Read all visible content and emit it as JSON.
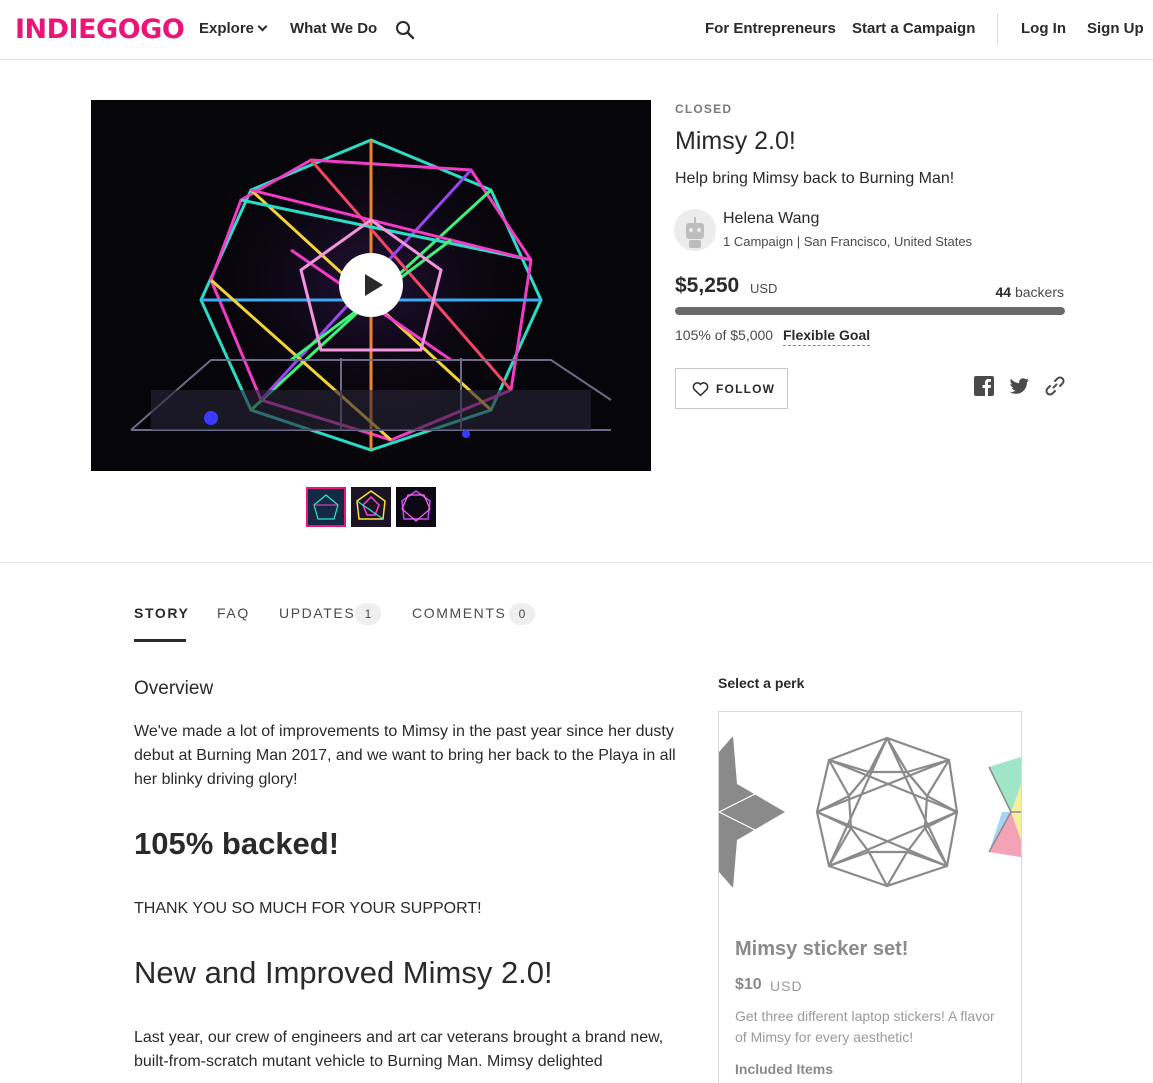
{
  "header": {
    "logo": "INDIEGOGO",
    "nav": {
      "explore": "Explore",
      "what_we_do": "What We Do",
      "for_entrepreneurs": "For Entrepreneurs",
      "start_campaign": "Start a Campaign",
      "log_in": "Log In",
      "sign_up": "Sign Up"
    },
    "search_icon": "search-icon"
  },
  "campaign": {
    "status": "CLOSED",
    "title": "Mimsy 2.0!",
    "tagline": "Help bring Mimsy back to Burning Man!",
    "owner": {
      "name": "Helena Wang",
      "meta": "1 Campaign | San Francisco, United States"
    },
    "funding": {
      "amount": "$5,250",
      "currency": "USD",
      "backers_count": "44",
      "backers_label": "backers",
      "percent_funded": 105,
      "goal_text": "105% of $5,000",
      "goal_type": "Flexible Goal"
    },
    "follow_label": "FOLLOW",
    "share_icons": [
      "facebook-icon",
      "twitter-icon",
      "link-icon"
    ],
    "media": {
      "play_icon": "play-icon",
      "thumbnail_count": 3,
      "selected_thumbnail": 1
    }
  },
  "tabs": {
    "story": "STORY",
    "faq": "FAQ",
    "updates": "UPDATES",
    "updates_count": "1",
    "comments": "COMMENTS",
    "comments_count": "0"
  },
  "story": {
    "overview_heading": "Overview",
    "paragraph1": "We've made a lot of improvements to Mimsy in the past year since her dusty debut at Burning Man 2017, and we want to bring her back to the Playa in all her blinky driving glory!",
    "heading_backed": "105% backed!",
    "thanks": "THANK YOU SO MUCH FOR YOUR SUPPORT!",
    "heading_new": "New and Improved Mimsy 2.0!",
    "paragraph2": "Last year, our crew of engineers and art car veterans brought a brand new, built-from-scratch mutant vehicle to Burning Man. Mimsy delighted"
  },
  "perk": {
    "select_label": "Select a perk",
    "title": "Mimsy sticker set!",
    "price": "$10",
    "currency": "USD",
    "description": "Get three different laptop stickers! A flavor of Mimsy for every aesthetic!",
    "included_items_label": "Included Items"
  },
  "colors": {
    "brand": "#eb1478",
    "text": "#2a2a2a",
    "progress_fill": "#6a6a6a"
  }
}
